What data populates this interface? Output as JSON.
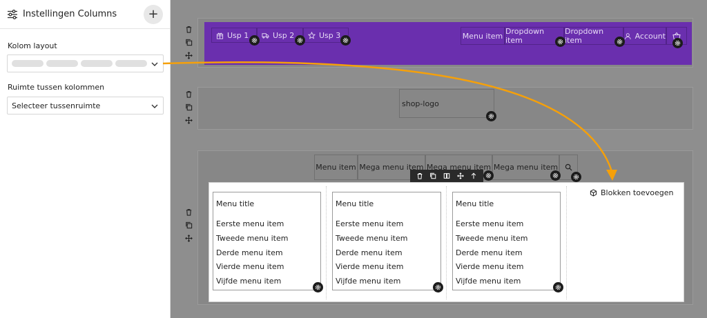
{
  "sidebar": {
    "title": "Instellingen Columns",
    "add_label": "+",
    "kolom_layout_label": "Kolom layout",
    "ruimte_label": "Ruimte tussen kolommen",
    "ruimte_select_value": "Selecteer tussenruimte"
  },
  "header_row": {
    "usps": [
      "Usp 1",
      "Usp 2",
      "Usp 3"
    ],
    "nav": [
      "Menu item",
      "Dropdown item",
      "Dropdown item",
      "Account"
    ]
  },
  "logo_row": {
    "logo_alt": "shop-logo"
  },
  "menu_row": {
    "items": [
      "Menu item",
      "Mega menu item",
      "Mega menu item",
      "Mega menu item"
    ]
  },
  "mega_panel": {
    "columns": [
      {
        "title": "Menu title",
        "items": [
          "Eerste menu item",
          "Tweede menu item",
          "Derde menu item",
          "Vierde menu item",
          "Vijfde menu item"
        ]
      },
      {
        "title": "Menu title",
        "items": [
          "Eerste menu item",
          "Tweede menu item",
          "Derde menu item",
          "Vierde menu item",
          "Vijfde menu item"
        ]
      },
      {
        "title": "Menu title",
        "items": [
          "Eerste menu item",
          "Tweede menu item",
          "Derde menu item",
          "Vierde menu item",
          "Vijfde menu item"
        ]
      }
    ],
    "add_blocks_label": "Blokken toevoegen"
  },
  "colors": {
    "purple": "#6a2fae",
    "arrow": "#f5a00a"
  }
}
